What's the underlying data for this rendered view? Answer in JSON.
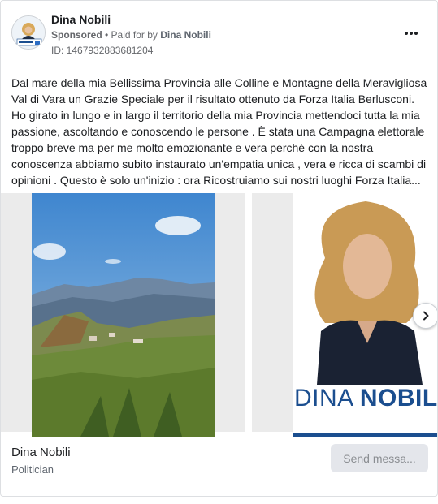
{
  "header": {
    "page_name": "Dina Nobili",
    "sponsored": "Sponsored",
    "separator": " • ",
    "paid_for_by": "Paid for by ",
    "paid_name": "Dina Nobili",
    "ad_id": "ID: 1467932883681204",
    "more_icon": "more-horizontal-icon"
  },
  "post": {
    "text": "Dal mare della mia Bellissima Provincia alle Colline e Montagne della Meravigliosa Val di Vara un Grazie Speciale per il risultato ottenuto da Forza Italia Berlusconi. Ho girato in lungo e in largo il territorio della mia Provincia mettendoci tutta la mia passione, ascoltando e conoscendo le persone . È stata una Campagna elettorale troppo breve ma per me molto emozionante e vera perché con la nostra conoscenza abbiamo subito instaurato un'empatia unica , vera e ricca di scambi di opinioni . Questo è solo un'inizio : ora Ricostruiamo sui nostri luoghi Forza Italia..."
  },
  "carousel": {
    "slide2_name_first": "DINA ",
    "slide2_name_last": "NOBILI",
    "next_icon": "chevron-right-icon"
  },
  "footer": {
    "name": "Dina Nobili",
    "category": "Politician",
    "send_label": "Send messa..."
  },
  "colors": {
    "brand_blue": "#1b4e8f",
    "button_bg": "#e4e6eb",
    "muted_text": "#65676b"
  }
}
